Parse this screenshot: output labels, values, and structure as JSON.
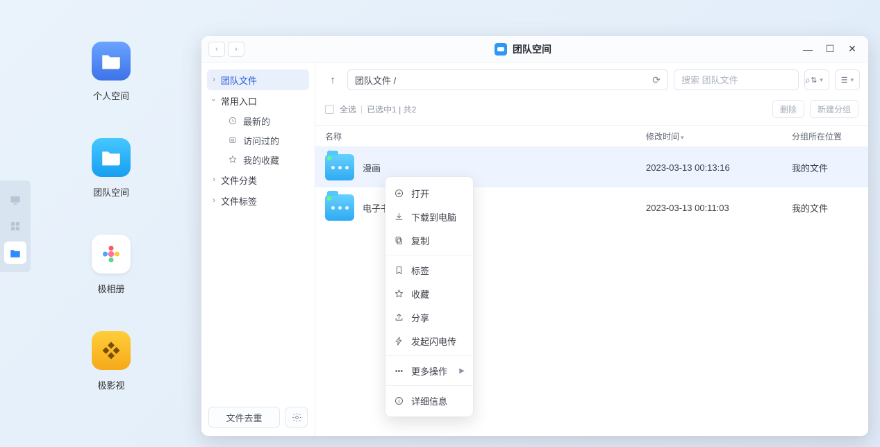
{
  "dock": {
    "items": [
      "display",
      "grid",
      "team"
    ]
  },
  "desktop_apps": [
    {
      "label": "个人空间",
      "icon": "personal"
    },
    {
      "label": "团队空间",
      "icon": "team"
    },
    {
      "label": "极相册",
      "icon": "photos"
    },
    {
      "label": "极影视",
      "icon": "video"
    }
  ],
  "window": {
    "title": "团队空间",
    "nav": {
      "back": "‹",
      "forward": "›"
    },
    "controls": {
      "minimize": "—",
      "maximize": "☐",
      "close": "✕"
    }
  },
  "sidebar": {
    "team_files": "团队文件",
    "common_entry": "常用入口",
    "recent": "最新的",
    "visited": "访问过的",
    "favorites": "我的收藏",
    "categories": "文件分类",
    "tags": "文件标签",
    "dedupe_btn": "文件去重"
  },
  "toolbar": {
    "path": "团队文件 /",
    "search_placeholder": "搜索 团队文件",
    "sort_tool": "⇅",
    "view_tool": "☰"
  },
  "selection_bar": {
    "select_all": "全选",
    "status": "已选中1 | 共2",
    "delete": "删除",
    "new_group": "新建分组"
  },
  "table": {
    "col_name": "名称",
    "col_time": "修改时间",
    "col_group": "分组所在位置",
    "rows": [
      {
        "name": "漫画",
        "time": "2023-03-13 00:13:16",
        "group": "我的文件",
        "selected": true
      },
      {
        "name": "电子书",
        "time": "2023-03-13 00:11:03",
        "group": "我的文件",
        "selected": false
      }
    ]
  },
  "context_menu": {
    "open": "打开",
    "download": "下载到电脑",
    "copy": "复制",
    "tag": "标签",
    "favorite": "收藏",
    "share": "分享",
    "flash_transfer": "发起闪电传",
    "more": "更多操作",
    "details": "详细信息"
  }
}
